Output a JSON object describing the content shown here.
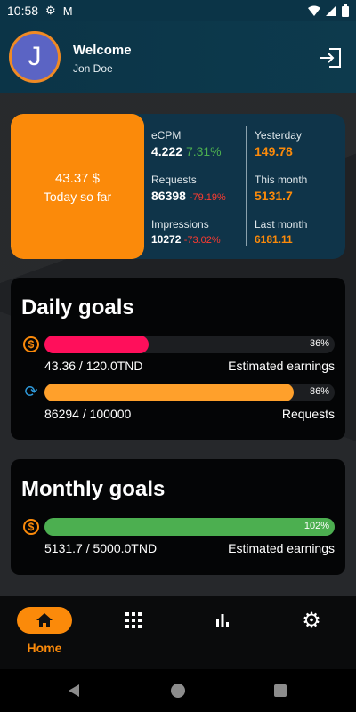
{
  "status_bar": {
    "time": "10:58"
  },
  "header": {
    "avatar_letter": "J",
    "welcome": "Welcome",
    "username": "Jon Doe"
  },
  "today": {
    "value": "43.37 $",
    "label": "Today so far"
  },
  "stats": {
    "ecpm_label": "eCPM",
    "ecpm_value": "4.222",
    "ecpm_change": "7.31%",
    "requests_label": "Requests",
    "requests_value": "86398",
    "requests_change": "-79.19%",
    "impressions_label": "Impressions",
    "impressions_value": "10272",
    "impressions_change": "-73.02%",
    "yesterday_label": "Yesterday",
    "yesterday_value": "149.78",
    "this_month_label": "This month",
    "this_month_value": "5131.7",
    "last_month_label": "Last month",
    "last_month_value": "6181.11"
  },
  "daily_goals": {
    "title": "Daily goals",
    "goals": [
      {
        "percent_label": "36%",
        "progress": 0.36,
        "text": "43.36 / 120.0TND",
        "label": "Estimated earnings",
        "color": "#ff0f5b"
      },
      {
        "percent_label": "86%",
        "progress": 0.86,
        "text": "86294 / 100000",
        "label": "Requests",
        "color": "#ffa02b"
      }
    ]
  },
  "monthly_goals": {
    "title": "Monthly goals",
    "goals": [
      {
        "percent_label": "102%",
        "progress": 1.0,
        "text": "5131.7 / 5000.0TND",
        "label": "Estimated earnings",
        "color": "#4caf50"
      }
    ]
  },
  "nav": {
    "home_label": "Home"
  },
  "colors": {
    "accent": "#fb8a0a",
    "header": "#0b3447",
    "card": "#040506"
  }
}
